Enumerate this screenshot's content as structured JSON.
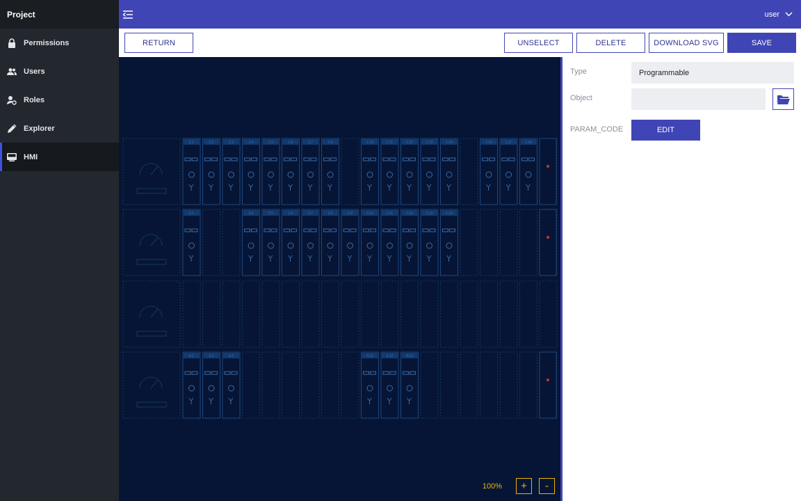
{
  "sidebar": {
    "project": "Project",
    "items": [
      {
        "label": "Permissions",
        "icon": "lock-icon"
      },
      {
        "label": "Users",
        "icon": "users-icon"
      },
      {
        "label": "Roles",
        "icon": "roles-icon"
      },
      {
        "label": "Explorer",
        "icon": "pencil-icon"
      },
      {
        "label": "HMI",
        "icon": "monitor-icon"
      }
    ],
    "active": "HMI"
  },
  "header": {
    "user": "user"
  },
  "toolbar": {
    "return_label": "RETURN",
    "unselect_label": "UNSELECT",
    "delete_label": "DELETE",
    "download_label": "DOWNLOAD SVG",
    "save_label": "SAVE"
  },
  "canvas": {
    "zoom": "100%",
    "zoom_in": "+",
    "zoom_out": "-",
    "background": "#061535",
    "accent": "#1a4a8a",
    "selected": "3.13",
    "rows": [
      {
        "slots": [
          "1.1",
          "1.2",
          "1.3",
          "1.4",
          "1.5",
          "1.6",
          "1.7",
          "1.8",
          "",
          "1.10",
          "1.11",
          "1.12",
          "1.13",
          "1.14",
          "",
          "1.16",
          "1.17",
          "1.18",
          ""
        ]
      },
      {
        "slots": [
          "2.1",
          "",
          "",
          "2.4",
          "2.5",
          "2.6",
          "2.7",
          "2.8",
          "2.9",
          "2.10",
          "2.11",
          "2.12",
          "2.13",
          "2.14",
          "",
          "",
          "",
          "",
          ""
        ]
      },
      {
        "slots": [
          "",
          "",
          "",
          "",
          "",
          "",
          "",
          "",
          "",
          "",
          "",
          "",
          "",
          "",
          "",
          "",
          "",
          "",
          ""
        ]
      },
      {
        "slots": [
          "4.1",
          "4.2",
          "4.3",
          "",
          "",
          "",
          "",
          "",
          "",
          "4.11",
          "4.12",
          "4.13",
          "",
          "",
          "",
          "",
          "",
          "",
          ""
        ]
      }
    ]
  },
  "panel": {
    "type_label": "Type",
    "type_value": "Programmable",
    "object_label": "Object",
    "object_value": "",
    "param_label": "PARAM_CODE",
    "edit_label": "EDIT"
  },
  "colors": {
    "brand": "#3f45b5",
    "sidebar": "#23272e",
    "zoom": "#f0b400"
  }
}
